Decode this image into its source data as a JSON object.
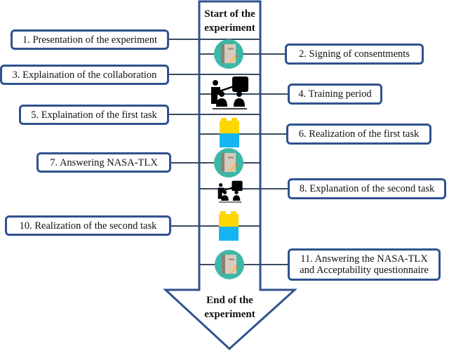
{
  "diagram": {
    "start_label_line1": "Start of the",
    "start_label_line2": "experiment",
    "end_label_line1": "End of the",
    "end_label_line2": "experiment",
    "colors": {
      "stroke": "#2F528F",
      "connector": "#3A4A63",
      "teal": "#3DB8A8",
      "notebook": "#D9CBBB",
      "notebook_spine": "#8C7F73",
      "pencil": "#F2C14E",
      "pencil_tip": "#E8604C",
      "yellow": "#FFD700",
      "blue": "#14B5F0",
      "black": "#000000"
    },
    "steps": [
      {
        "label": "1. Presentation of the experiment",
        "side": "left"
      },
      {
        "label": "2. Signing of consentments",
        "side": "right",
        "icon": "notebook-icon"
      },
      {
        "label": "3. Explaination of the collaboration",
        "side": "left"
      },
      {
        "label": "4. Training period",
        "side": "right",
        "icon": "teacher-classroom-icon"
      },
      {
        "label": "5. Explaination of the first task",
        "side": "left"
      },
      {
        "label": "6. Realization of the first task",
        "side": "right",
        "icon": "lego-brick-icon"
      },
      {
        "label": "7. Answering NASA-TLX",
        "side": "left",
        "icon": "notebook-icon"
      },
      {
        "label": "8. Explanation of the second task",
        "side": "right",
        "icon": "teacher-classroom-icon"
      },
      {
        "label": "10. Realization of the second task",
        "side": "left",
        "icon": "lego-brick-icon"
      },
      {
        "label_line1": "11. Answering the NASA-TLX",
        "label_line2": "and Acceptability questionnaire",
        "side": "right",
        "icon": "notebook-icon"
      }
    ]
  }
}
